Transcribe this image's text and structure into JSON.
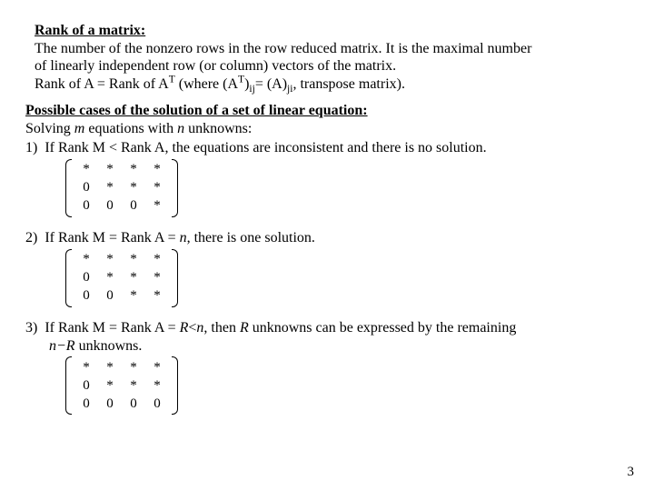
{
  "rank": {
    "heading": "Rank of a matrix:",
    "line1a": "The number of the nonzero rows in the row reduced matrix.  It is the maximal number",
    "line1b": "of linearly independent row (or column) vectors of the matrix.",
    "line2_pre": "Rank of A = Rank of A",
    "T": "T",
    "where_open": " (where (A",
    "ij_eq": "= (A)",
    "ji": "ji",
    "tail": ", transpose matrix).",
    "ij": "ij",
    "close_paren": ")"
  },
  "cases": {
    "heading": "Possible cases of the solution of  a set of linear equation:",
    "solving_pre": "Solving ",
    "m": "m",
    "solving_mid": " equations with ",
    "n": "n",
    "solving_post": " unknowns:",
    "c1_num": "1)",
    "c1_text": "If Rank M < Rank A, the equations are inconsistent and there is no solution.",
    "c2_num": "2)",
    "c2_pre": "If Rank M = Rank A  = ",
    "c2_post": ", there is one solution.",
    "c3_num": "3)",
    "c3_pre": "If Rank M = Rank A  = ",
    "R": "R",
    "lt": "<",
    "c3_mid": ", then ",
    "c3_mid2": " unknowns can be expressed by the remaining",
    "c3_line2_pre": "",
    "minus": "−",
    "c3_line2_post": " unknowns."
  },
  "mat1": [
    [
      "*",
      "*",
      "*",
      "*"
    ],
    [
      "0",
      "*",
      "*",
      "*"
    ],
    [
      "0",
      "0",
      "0",
      "*"
    ]
  ],
  "mat2": [
    [
      "*",
      "*",
      "*",
      "*"
    ],
    [
      "0",
      "*",
      "*",
      "*"
    ],
    [
      "0",
      "0",
      "*",
      "*"
    ]
  ],
  "mat3": [
    [
      "*",
      "*",
      "*",
      "*"
    ],
    [
      "0",
      "*",
      "*",
      "*"
    ],
    [
      "0",
      "0",
      "0",
      "0"
    ]
  ],
  "pagenum": "3"
}
